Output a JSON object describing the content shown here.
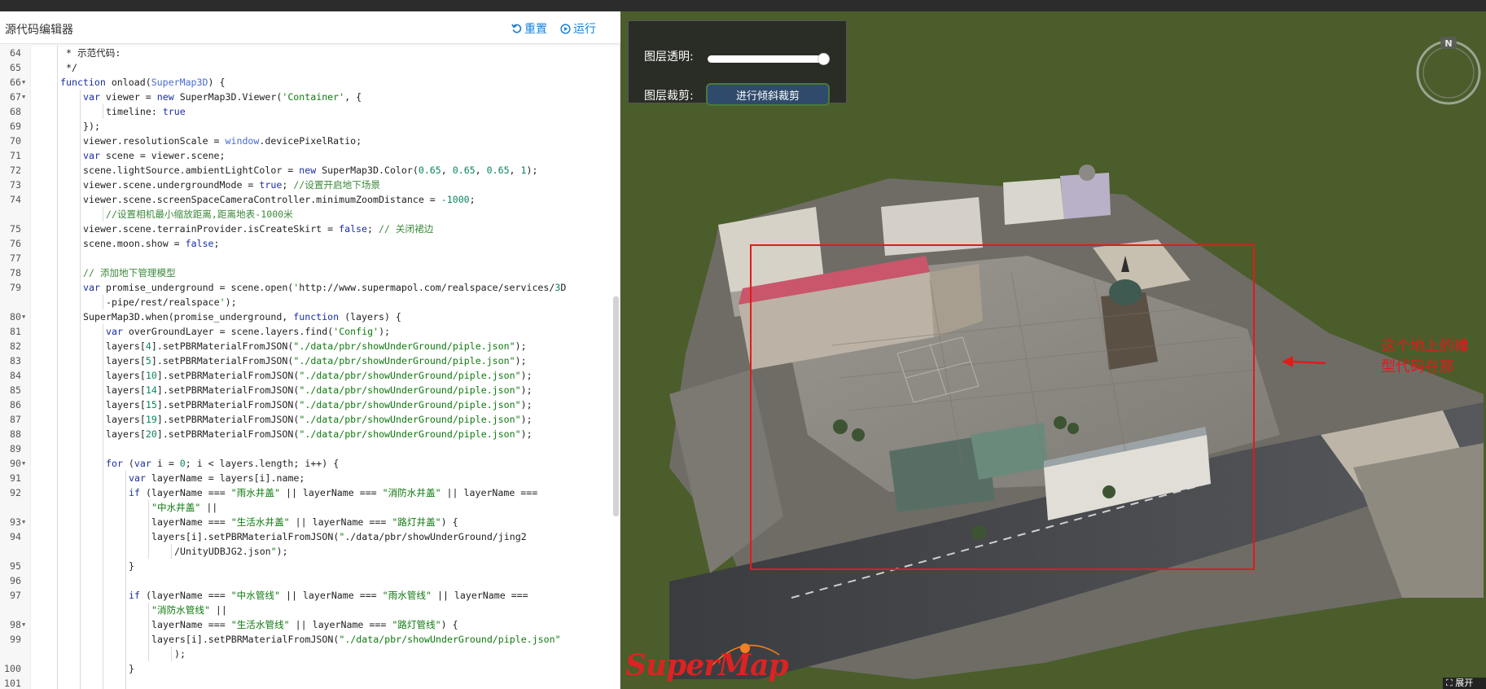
{
  "editor": {
    "title": "源代码编辑器",
    "reset_label": "重置",
    "run_label": "运行"
  },
  "code_lines": [
    {
      "n": "64",
      "fold": false,
      "indent": 2,
      "text": " * 示范代码:"
    },
    {
      "n": "65",
      "fold": false,
      "indent": 2,
      "text": " */"
    },
    {
      "n": "66",
      "fold": true,
      "indent": 2,
      "text": "function onload(SuperMap3D) {"
    },
    {
      "n": "67",
      "fold": true,
      "indent": 3,
      "text": "var viewer = new SuperMap3D.Viewer('Container', {"
    },
    {
      "n": "68",
      "fold": false,
      "indent": 4,
      "text": "timeline: true"
    },
    {
      "n": "69",
      "fold": false,
      "indent": 3,
      "text": "});"
    },
    {
      "n": "70",
      "fold": false,
      "indent": 3,
      "text": "viewer.resolutionScale = window.devicePixelRatio;"
    },
    {
      "n": "71",
      "fold": false,
      "indent": 3,
      "text": "var scene = viewer.scene;"
    },
    {
      "n": "72",
      "fold": false,
      "indent": 3,
      "text": "scene.lightSource.ambientLightColor = new SuperMap3D.Color(0.65, 0.65, 0.65, 1);"
    },
    {
      "n": "73",
      "fold": false,
      "indent": 3,
      "text": "viewer.scene.undergroundMode = true; //设置开启地下场景"
    },
    {
      "n": "74",
      "fold": false,
      "indent": 3,
      "text": "viewer.scene.screenSpaceCameraController.minimumZoomDistance = -1000;"
    },
    {
      "n": "",
      "fold": false,
      "indent": 4,
      "text": "//设置相机最小缩放距离,距离地表-1000米"
    },
    {
      "n": "75",
      "fold": false,
      "indent": 3,
      "text": "viewer.scene.terrainProvider.isCreateSkirt = false; // 关闭裙边"
    },
    {
      "n": "76",
      "fold": false,
      "indent": 3,
      "text": "scene.moon.show = false;"
    },
    {
      "n": "77",
      "fold": false,
      "indent": 3,
      "text": ""
    },
    {
      "n": "78",
      "fold": false,
      "indent": 3,
      "text": "// 添加地下管理模型"
    },
    {
      "n": "79",
      "fold": false,
      "indent": 3,
      "text": "var promise_underground = scene.open('http://www.supermapol.com/realspace/services/3D"
    },
    {
      "n": "",
      "fold": false,
      "indent": 4,
      "text": "-pipe/rest/realspace');"
    },
    {
      "n": "80",
      "fold": true,
      "indent": 3,
      "text": "SuperMap3D.when(promise_underground, function (layers) {"
    },
    {
      "n": "81",
      "fold": false,
      "indent": 4,
      "text": "var overGroundLayer = scene.layers.find('Config');"
    },
    {
      "n": "82",
      "fold": false,
      "indent": 4,
      "text": "layers[4].setPBRMaterialFromJSON(\"./data/pbr/showUnderGround/piple.json\");"
    },
    {
      "n": "83",
      "fold": false,
      "indent": 4,
      "text": "layers[5].setPBRMaterialFromJSON(\"./data/pbr/showUnderGround/piple.json\");"
    },
    {
      "n": "84",
      "fold": false,
      "indent": 4,
      "text": "layers[10].setPBRMaterialFromJSON(\"./data/pbr/showUnderGround/piple.json\");"
    },
    {
      "n": "85",
      "fold": false,
      "indent": 4,
      "text": "layers[14].setPBRMaterialFromJSON(\"./data/pbr/showUnderGround/piple.json\");"
    },
    {
      "n": "86",
      "fold": false,
      "indent": 4,
      "text": "layers[15].setPBRMaterialFromJSON(\"./data/pbr/showUnderGround/piple.json\");"
    },
    {
      "n": "87",
      "fold": false,
      "indent": 4,
      "text": "layers[19].setPBRMaterialFromJSON(\"./data/pbr/showUnderGround/piple.json\");"
    },
    {
      "n": "88",
      "fold": false,
      "indent": 4,
      "text": "layers[20].setPBRMaterialFromJSON(\"./data/pbr/showUnderGround/piple.json\");"
    },
    {
      "n": "89",
      "fold": false,
      "indent": 4,
      "text": ""
    },
    {
      "n": "90",
      "fold": true,
      "indent": 4,
      "text": "for (var i = 0; i < layers.length; i++) {"
    },
    {
      "n": "91",
      "fold": false,
      "indent": 5,
      "text": "var layerName = layers[i].name;"
    },
    {
      "n": "92",
      "fold": false,
      "indent": 5,
      "text": "if (layerName === \"雨水井盖\" || layerName === \"消防水井盖\" || layerName ==="
    },
    {
      "n": "",
      "fold": false,
      "indent": 6,
      "text": "\"中水井盖\" ||"
    },
    {
      "n": "93",
      "fold": true,
      "indent": 6,
      "text": "layerName === \"生活水井盖\" || layerName === \"路灯井盖\") {"
    },
    {
      "n": "94",
      "fold": false,
      "indent": 6,
      "text": "layers[i].setPBRMaterialFromJSON(\"./data/pbr/showUnderGround/jing2"
    },
    {
      "n": "",
      "fold": false,
      "indent": 7,
      "text": "/UnityUDBJG2.json\");"
    },
    {
      "n": "95",
      "fold": false,
      "indent": 5,
      "text": "}"
    },
    {
      "n": "96",
      "fold": false,
      "indent": 5,
      "text": ""
    },
    {
      "n": "97",
      "fold": false,
      "indent": 5,
      "text": "if (layerName === \"中水管线\" || layerName === \"雨水管线\" || layerName ==="
    },
    {
      "n": "",
      "fold": false,
      "indent": 6,
      "text": "\"消防水管线\" ||"
    },
    {
      "n": "98",
      "fold": true,
      "indent": 6,
      "text": "layerName === \"生活水管线\" || layerName === \"路灯管线\") {"
    },
    {
      "n": "99",
      "fold": false,
      "indent": 6,
      "text": "layers[i].setPBRMaterialFromJSON(\"./data/pbr/showUnderGround/piple.json\""
    },
    {
      "n": "",
      "fold": false,
      "indent": 7,
      "text": ");"
    },
    {
      "n": "100",
      "fold": false,
      "indent": 5,
      "text": "}"
    },
    {
      "n": "101",
      "fold": false,
      "indent": 5,
      "text": ""
    }
  ],
  "viewer": {
    "opacity_label": "图层透明:",
    "opacity_value": 1.0,
    "clip_label": "图层裁剪:",
    "clip_button": "进行倾斜裁剪",
    "compass_letter": "N",
    "expand_label": "展开",
    "logo": "SuperMap",
    "annotation": "这个地上的模型代码在那",
    "annotation_color": "#e21b1b",
    "highlight_color": "#e21b1b"
  },
  "colors": {
    "accent": "#1e7fd1",
    "ground": "#4a5d2b"
  }
}
